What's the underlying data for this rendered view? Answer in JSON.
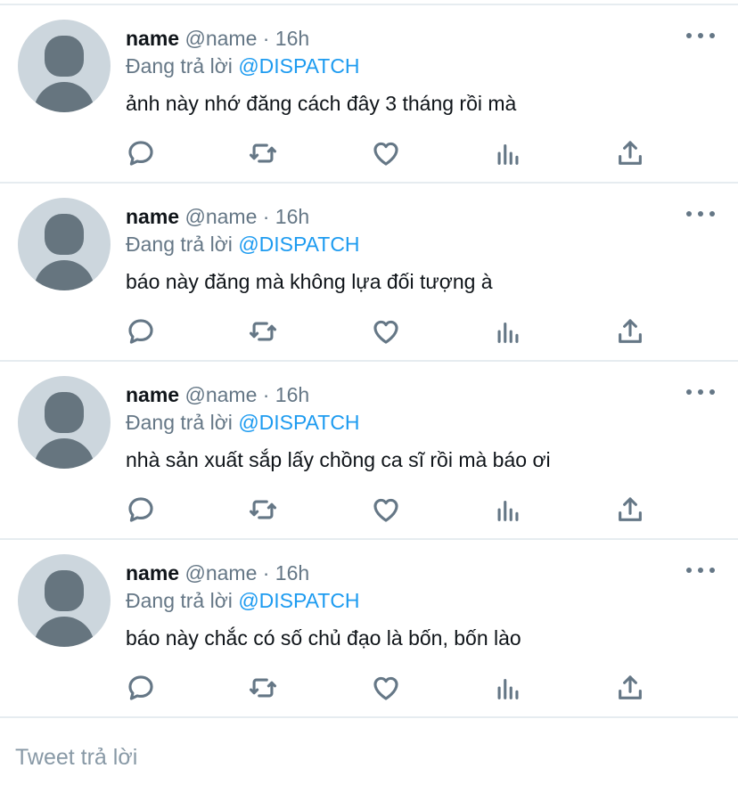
{
  "replies": [
    {
      "name": "name",
      "meta": "@name · 16h",
      "replying_prefix": "Đang trả lời",
      "replying_to": "@DISPATCH",
      "text": "ảnh này nhớ đăng cách đây 3 tháng rồi mà"
    },
    {
      "name": "name",
      "meta": "@name · 16h",
      "replying_prefix": "Đang trả lời",
      "replying_to": "@DISPATCH",
      "text": "báo này đăng mà không lựa đối tượng à"
    },
    {
      "name": "name",
      "meta": "@name · 16h",
      "replying_prefix": "Đang trả lời",
      "replying_to": "@DISPATCH",
      "text": "nhà sản xuất sắp lấy chồng ca sĩ rồi mà báo ơi"
    },
    {
      "name": "name",
      "meta": "@name · 16h",
      "replying_prefix": "Đang trả lời",
      "replying_to": "@DISPATCH",
      "text": "báo này chắc có số chủ đạo là bốn, bốn lào"
    }
  ],
  "icons": [
    "avatar-placeholder",
    "more-icon",
    "reply-icon",
    "retweet-icon",
    "like-icon",
    "analytics-icon",
    "share-icon"
  ],
  "colors": {
    "mention": "#1d9bf0",
    "secondary_text": "#657786",
    "divider": "#e6ecf0",
    "avatar_bg": "#ccd6dd"
  },
  "compose": {
    "placeholder": "Tweet trả lời"
  }
}
